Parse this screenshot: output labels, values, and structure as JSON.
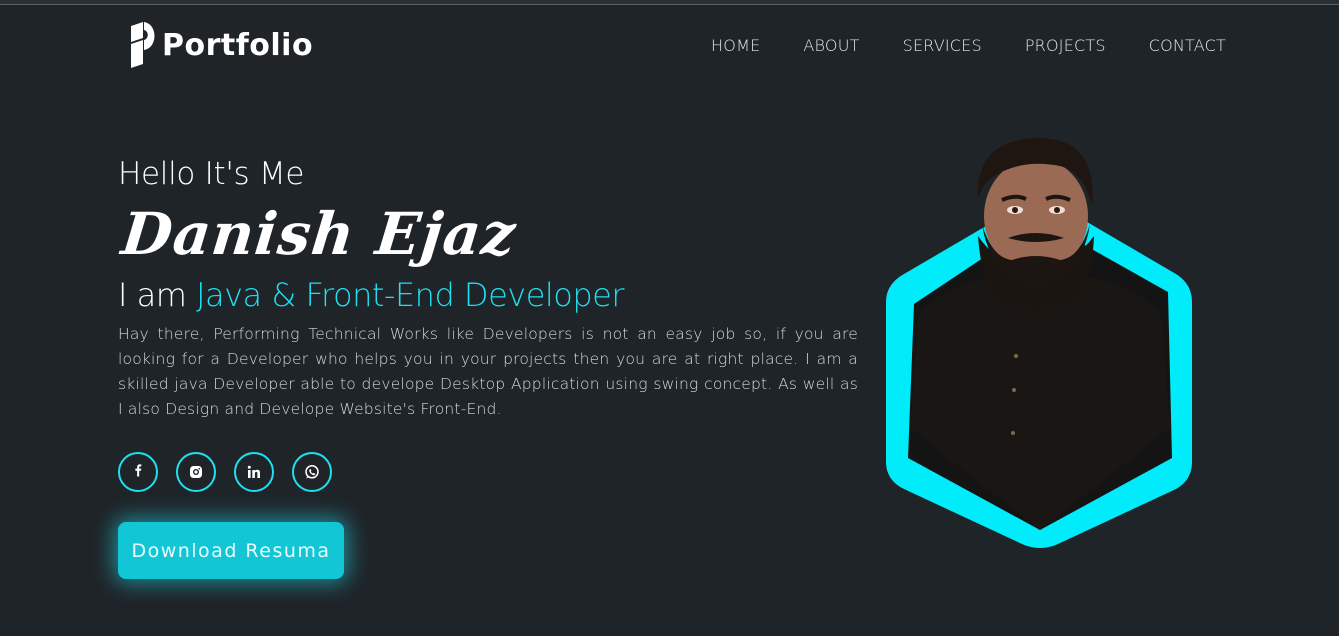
{
  "header": {
    "logo_text": "Portfolio",
    "nav": [
      "HOME",
      "ABOUT",
      "SERVICES",
      "PROJECTS",
      "CONTACT"
    ]
  },
  "hero": {
    "greeting": "Hello It's Me",
    "name": "Danish Ejaz",
    "role_prefix": "I am",
    "role_highlight": "Java & Front-End Developer",
    "description": "Hay there, Performing Technical Works like Developers is not an easy job so, if you are looking for a Developer who helps you in your projects then you are at right place. I am a skilled java Developer able to develope Desktop Application using swing concept. As well as I also Design and Develope Website's Front-End.",
    "socials": [
      {
        "icon": "facebook-icon"
      },
      {
        "icon": "instagram-icon"
      },
      {
        "icon": "linkedin-icon"
      },
      {
        "icon": "whatsapp-icon"
      }
    ],
    "button_label": "Download Resuma"
  },
  "colors": {
    "background": "#1f2428",
    "accent": "#1fe0f2",
    "button": "#12c6d6"
  }
}
